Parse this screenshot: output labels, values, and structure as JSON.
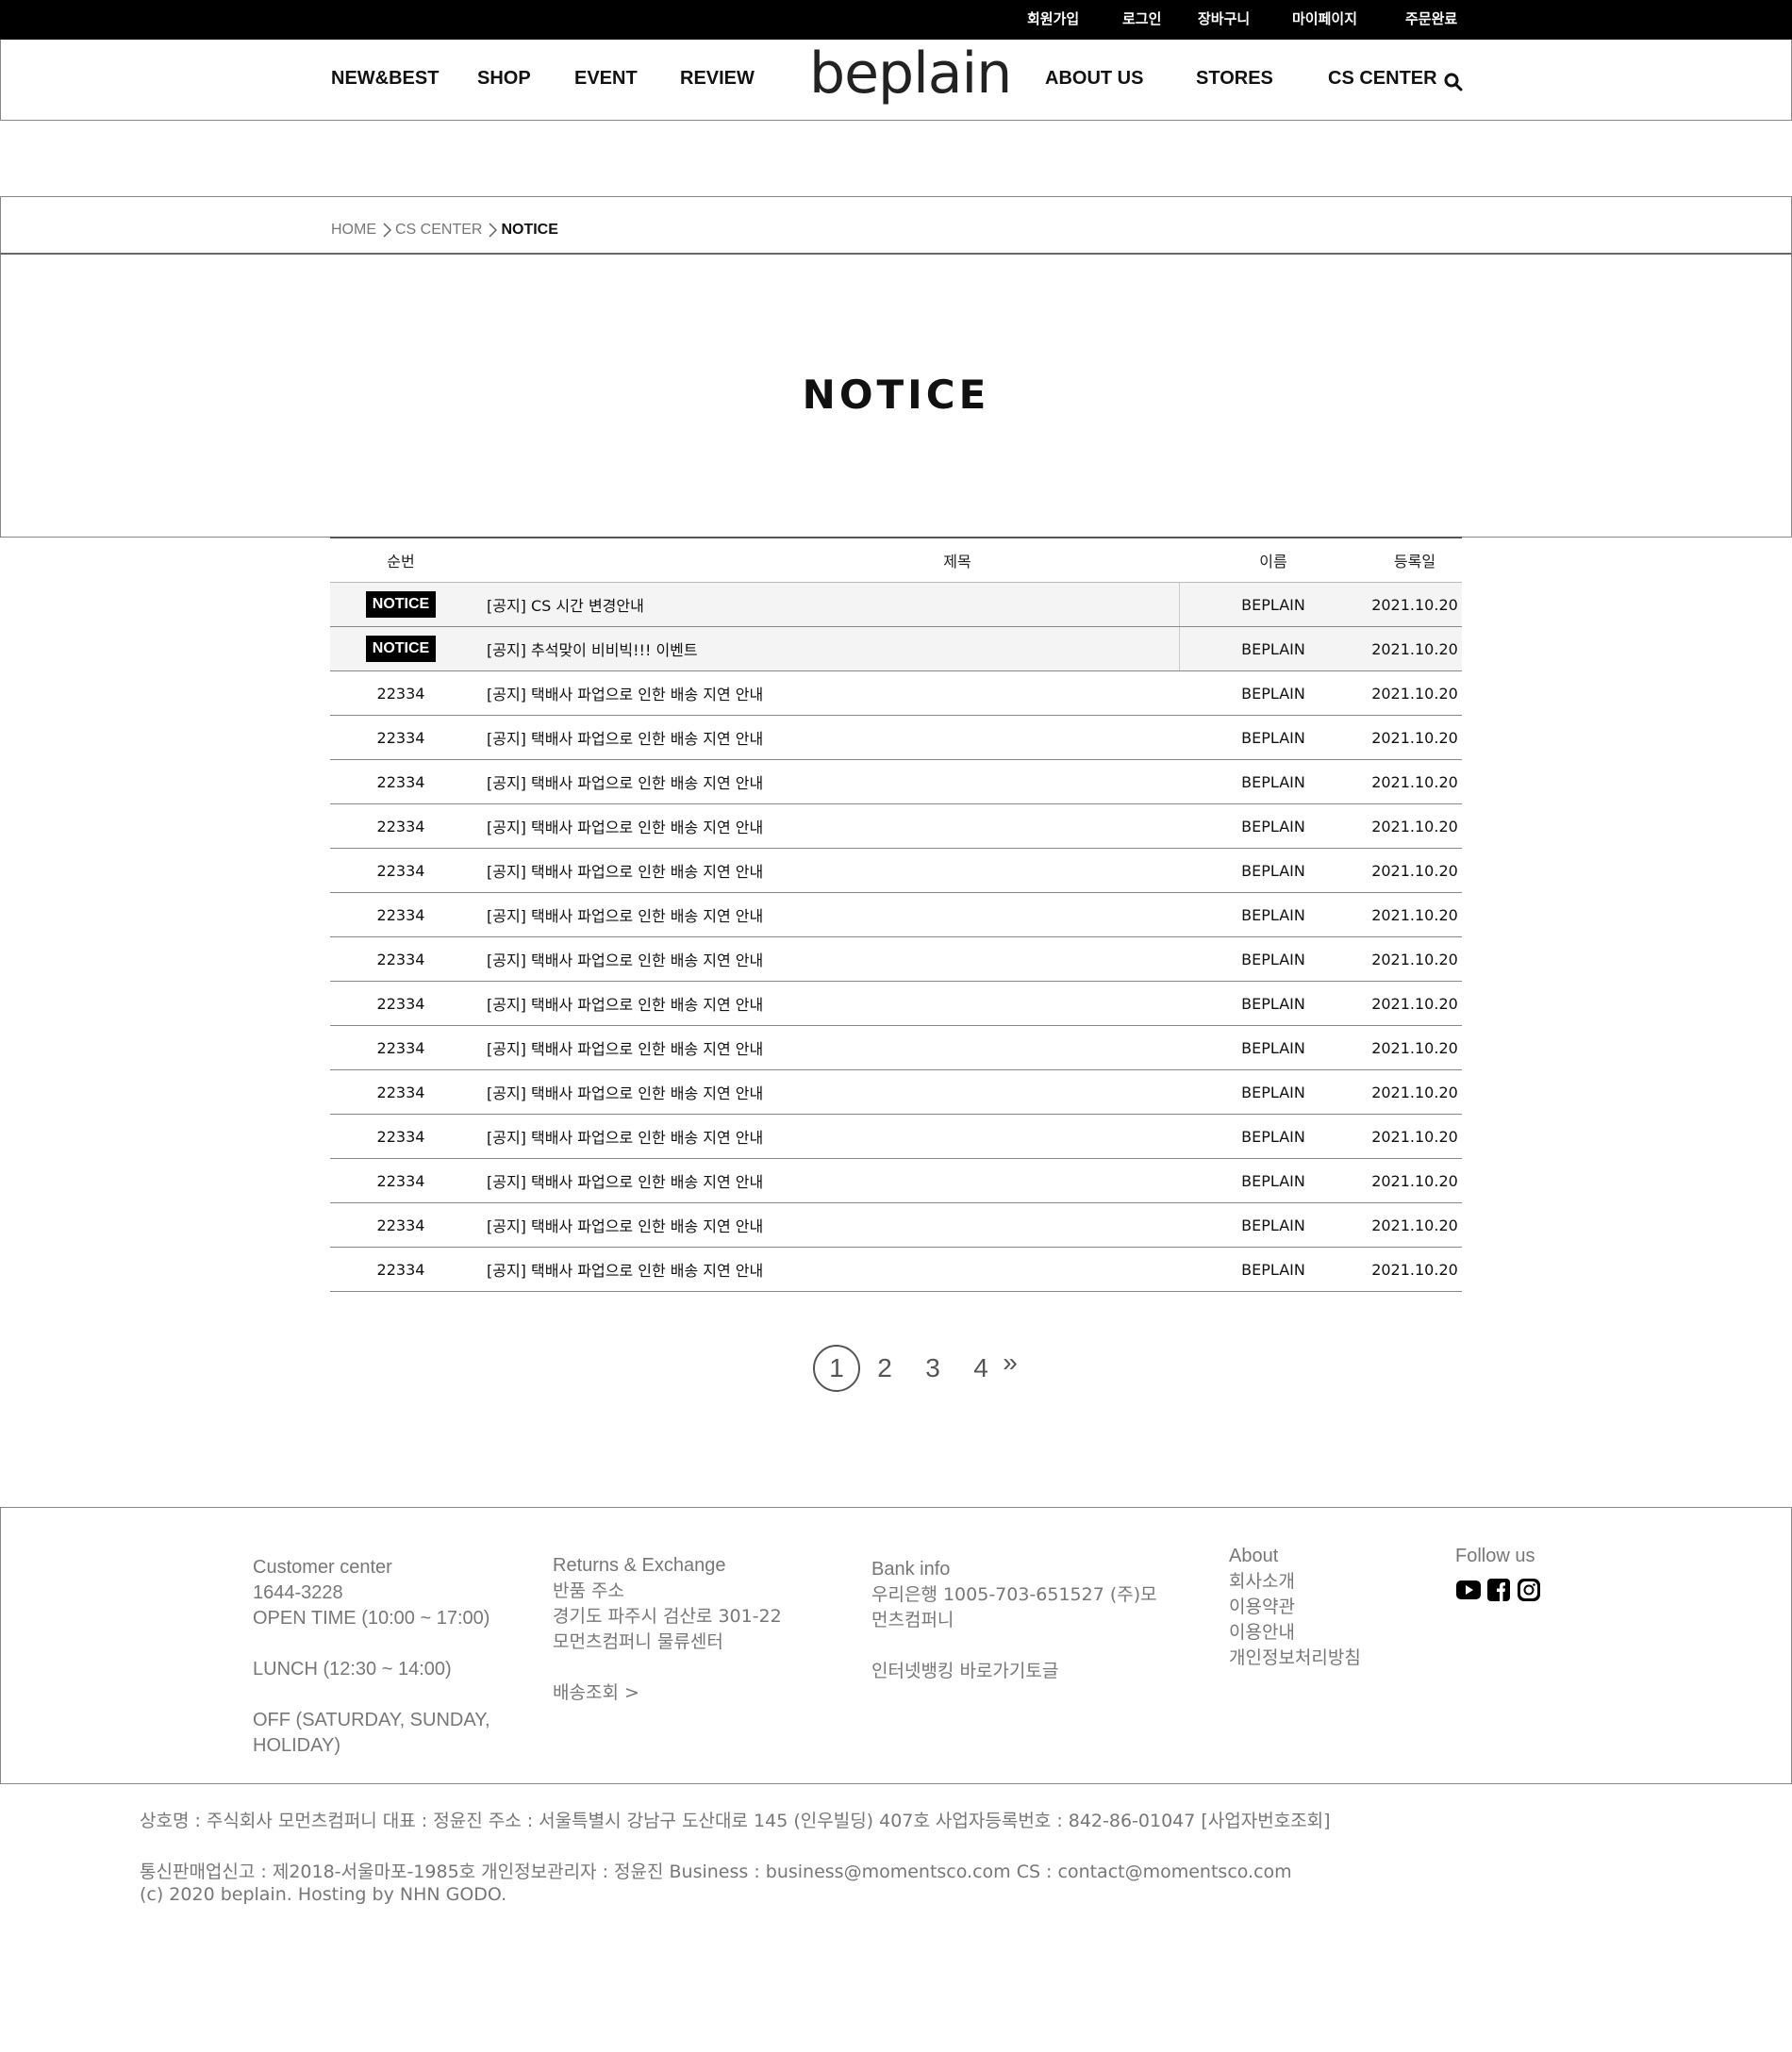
{
  "topbar": {
    "links": [
      "회원가입",
      "로그인",
      "장바구니",
      "마이페이지",
      "주문완료"
    ]
  },
  "nav": {
    "left": [
      "NEW&BEST",
      "SHOP",
      "EVENT",
      "REVIEW"
    ],
    "logo": "beplain",
    "right": [
      "ABOUT US",
      "STORES",
      "CS CENTER"
    ]
  },
  "breadcrumb": [
    "HOME",
    "CS CENTER",
    "NOTICE"
  ],
  "page_title": "NOTICE",
  "table": {
    "headers": [
      "순번",
      "제목",
      "이름",
      "등록일"
    ],
    "rows": [
      {
        "no": "NOTICE",
        "title": "[공지] CS 시간 변경안내",
        "name": "BEPLAIN",
        "date": "2021.10.20"
      },
      {
        "no": "NOTICE",
        "title": "[공지] 추석맞이 비비빅!!! 이벤트",
        "name": "BEPLAIN",
        "date": "2021.10.20"
      },
      {
        "no": "22334",
        "title": "[공지] 택배사 파업으로 인한 배송 지연 안내",
        "name": "BEPLAIN",
        "date": "2021.10.20"
      },
      {
        "no": "22334",
        "title": "[공지] 택배사 파업으로 인한 배송 지연 안내",
        "name": "BEPLAIN",
        "date": "2021.10.20"
      },
      {
        "no": "22334",
        "title": "[공지] 택배사 파업으로 인한 배송 지연 안내",
        "name": "BEPLAIN",
        "date": "2021.10.20"
      },
      {
        "no": "22334",
        "title": "[공지] 택배사 파업으로 인한 배송 지연 안내",
        "name": "BEPLAIN",
        "date": "2021.10.20"
      },
      {
        "no": "22334",
        "title": "[공지] 택배사 파업으로 인한 배송 지연 안내",
        "name": "BEPLAIN",
        "date": "2021.10.20"
      },
      {
        "no": "22334",
        "title": "[공지] 택배사 파업으로 인한 배송 지연 안내",
        "name": "BEPLAIN",
        "date": "2021.10.20"
      },
      {
        "no": "22334",
        "title": "[공지] 택배사 파업으로 인한 배송 지연 안내",
        "name": "BEPLAIN",
        "date": "2021.10.20"
      },
      {
        "no": "22334",
        "title": "[공지] 택배사 파업으로 인한 배송 지연 안내",
        "name": "BEPLAIN",
        "date": "2021.10.20"
      },
      {
        "no": "22334",
        "title": "[공지] 택배사 파업으로 인한 배송 지연 안내",
        "name": "BEPLAIN",
        "date": "2021.10.20"
      },
      {
        "no": "22334",
        "title": "[공지] 택배사 파업으로 인한 배송 지연 안내",
        "name": "BEPLAIN",
        "date": "2021.10.20"
      },
      {
        "no": "22334",
        "title": "[공지] 택배사 파업으로 인한 배송 지연 안내",
        "name": "BEPLAIN",
        "date": "2021.10.20"
      },
      {
        "no": "22334",
        "title": "[공지] 택배사 파업으로 인한 배송 지연 안내",
        "name": "BEPLAIN",
        "date": "2021.10.20"
      },
      {
        "no": "22334",
        "title": "[공지] 택배사 파업으로 인한 배송 지연 안내",
        "name": "BEPLAIN",
        "date": "2021.10.20"
      },
      {
        "no": "22334",
        "title": "[공지] 택배사 파업으로 인한 배송 지연 안내",
        "name": "BEPLAIN",
        "date": "2021.10.20"
      }
    ]
  },
  "pagination": {
    "pages": [
      "1",
      "2",
      "3",
      "4"
    ],
    "current": "1",
    "next": "»"
  },
  "footer": {
    "customer": {
      "title": "Customer center",
      "phone": "1644-3228",
      "open": "OPEN TIME (10:00 ~ 17:00)",
      "lunch": "LUNCH (12:30 ~ 14:00)",
      "off1": "OFF (SATURDAY, SUNDAY,",
      "off2": "HOLIDAY)"
    },
    "returns": {
      "title": "Returns & Exchange",
      "label": "반품 주소",
      "addr1": "경기도 파주시 검산로 301-22",
      "addr2": "모먼츠컴퍼니 물류센터",
      "track": "배송조회 >"
    },
    "bank": {
      "title": "Bank info",
      "line1": "우리은행 1005-703-651527 (주)모",
      "line2": "먼츠컴퍼니",
      "link": "인터넷뱅킹 바로가기토글"
    },
    "about": {
      "title": "About",
      "items": [
        "회사소개",
        "이용약관",
        "이용안내",
        "개인정보처리방침"
      ]
    },
    "follow": {
      "title": "Follow us",
      "icons": [
        "youtube-icon",
        "facebook-icon",
        "instagram-icon"
      ]
    }
  },
  "company": {
    "line1": "상호명 : 주식회사 모먼츠컴퍼니 대표 : 정윤진 주소 : 서울특별시 강남구 도산대로 145 (인우빌딩) 407호 사업자등록번호 : 842-86-01047 [사업자번호조회]",
    "line2": "통신판매업신고 : 제2018-서울마포-1985호 개인정보관리자 : 정윤진 Business : business@momentsco.com CS : contact@momentsco.com",
    "line3": "(c) 2020 beplain. Hosting by NHN GODO."
  }
}
